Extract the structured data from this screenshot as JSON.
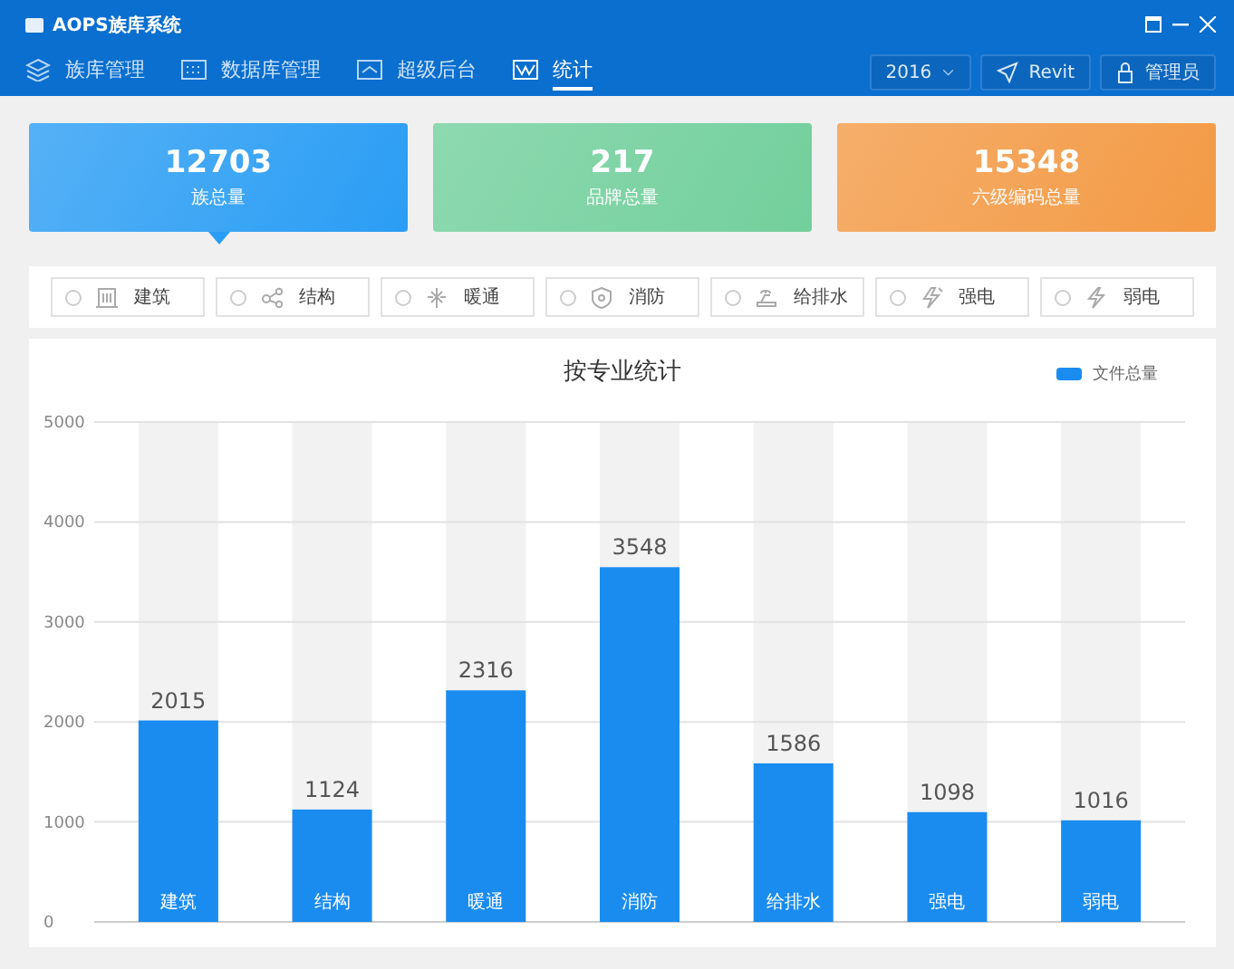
{
  "window": {
    "title": "AOPS族库系统"
  },
  "nav": [
    {
      "label": "族库管理",
      "selected": false
    },
    {
      "label": "数据库管理",
      "selected": false
    },
    {
      "label": "超级后台",
      "selected": false
    },
    {
      "label": "统计",
      "selected": true
    }
  ],
  "toolbar": {
    "year": "2016",
    "revit": "Revit",
    "user": "管理员"
  },
  "stats": [
    {
      "value": "12703",
      "label": "族总量",
      "color": "#2a9df4",
      "selected": true
    },
    {
      "value": "217",
      "label": "品牌总量",
      "color": "#72cf9c",
      "selected": false
    },
    {
      "value": "15348",
      "label": "六级编码总量",
      "color": "#f39a45",
      "selected": false
    }
  ],
  "filters": [
    {
      "label": "建筑",
      "selected": false
    },
    {
      "label": "结构",
      "selected": false
    },
    {
      "label": "暖通",
      "selected": false
    },
    {
      "label": "消防",
      "selected": false
    },
    {
      "label": "给排水",
      "selected": false
    },
    {
      "label": "强电",
      "selected": false
    },
    {
      "label": "弱电",
      "selected": false
    }
  ],
  "chart_data": {
    "type": "bar",
    "title": "按专业统计",
    "categories": [
      "建筑",
      "结构",
      "暖通",
      "消防",
      "给排水",
      "强电",
      "弱电"
    ],
    "series": [
      {
        "name": "文件总量",
        "color": "#1a8cf0",
        "values": [
          2015,
          1124,
          2316,
          3548,
          1586,
          1098,
          1016
        ]
      }
    ],
    "grid": true,
    "ylim": [
      0,
      5000
    ],
    "yticks": [
      0,
      1000,
      2000,
      3000,
      4000,
      5000
    ],
    "data_labels": true
  }
}
